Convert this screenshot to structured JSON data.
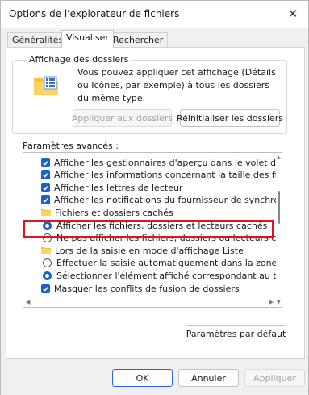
{
  "window": {
    "title": "Options de l'explorateur de fichiers",
    "close_glyph": "✕"
  },
  "tabs": [
    {
      "label": "Généralités",
      "active": false
    },
    {
      "label": "Visualiser",
      "active": true
    },
    {
      "label": "Rechercher",
      "active": false
    }
  ],
  "folder_view": {
    "group_label": "Affichage des dossiers",
    "description": "Vous pouvez appliquer cet affichage (Détails ou Icônes, par exemple) à tous les dossiers du même type.",
    "apply_button": "Appliquer aux dossiers",
    "reset_button": "Réinitialiser les dossiers",
    "icon": "folder-view-icon"
  },
  "advanced": {
    "label": "Paramètres avancés :",
    "items": [
      {
        "type": "checkbox",
        "checked": true,
        "indent": 1,
        "label": "Afficher les gestionnaires d'aperçu dans le volet de visual"
      },
      {
        "type": "checkbox",
        "checked": true,
        "indent": 1,
        "label": "Afficher les informations concernant la taille des fichiers d"
      },
      {
        "type": "checkbox",
        "checked": true,
        "indent": 1,
        "label": "Afficher les lettres de lecteur"
      },
      {
        "type": "checkbox",
        "checked": true,
        "indent": 1,
        "label": "Afficher les notifications du fournisseur de synchronisation"
      },
      {
        "type": "folder",
        "indent": 1,
        "label": "Fichiers et dossiers cachés"
      },
      {
        "type": "radio",
        "checked": true,
        "indent": 2,
        "label": "Afficher les fichiers, dossiers et lecteurs cachés"
      },
      {
        "type": "radio",
        "checked": false,
        "indent": 2,
        "label": "Ne pas afficher les fichiers, dossiers ou lecteurs cachés"
      },
      {
        "type": "folder",
        "indent": 1,
        "label": "Lors de la saisie en mode d'affichage Liste"
      },
      {
        "type": "radio",
        "checked": false,
        "indent": 2,
        "label": "Effectuer la saisie automatiquement dans la zone Rec"
      },
      {
        "type": "radio",
        "checked": true,
        "indent": 2,
        "label": "Sélectionner l'élément affiché correspondant au texte"
      },
      {
        "type": "checkbox",
        "checked": true,
        "indent": 1,
        "label": "Masquer les conflits de fusion de dossiers"
      }
    ]
  },
  "defaults_button": "Paramètres par défaut",
  "footer": {
    "ok": "OK",
    "cancel": "Annuler",
    "apply": "Appliquer"
  },
  "colors": {
    "accent": "#1f5fc9",
    "highlight": "#e0141e"
  }
}
